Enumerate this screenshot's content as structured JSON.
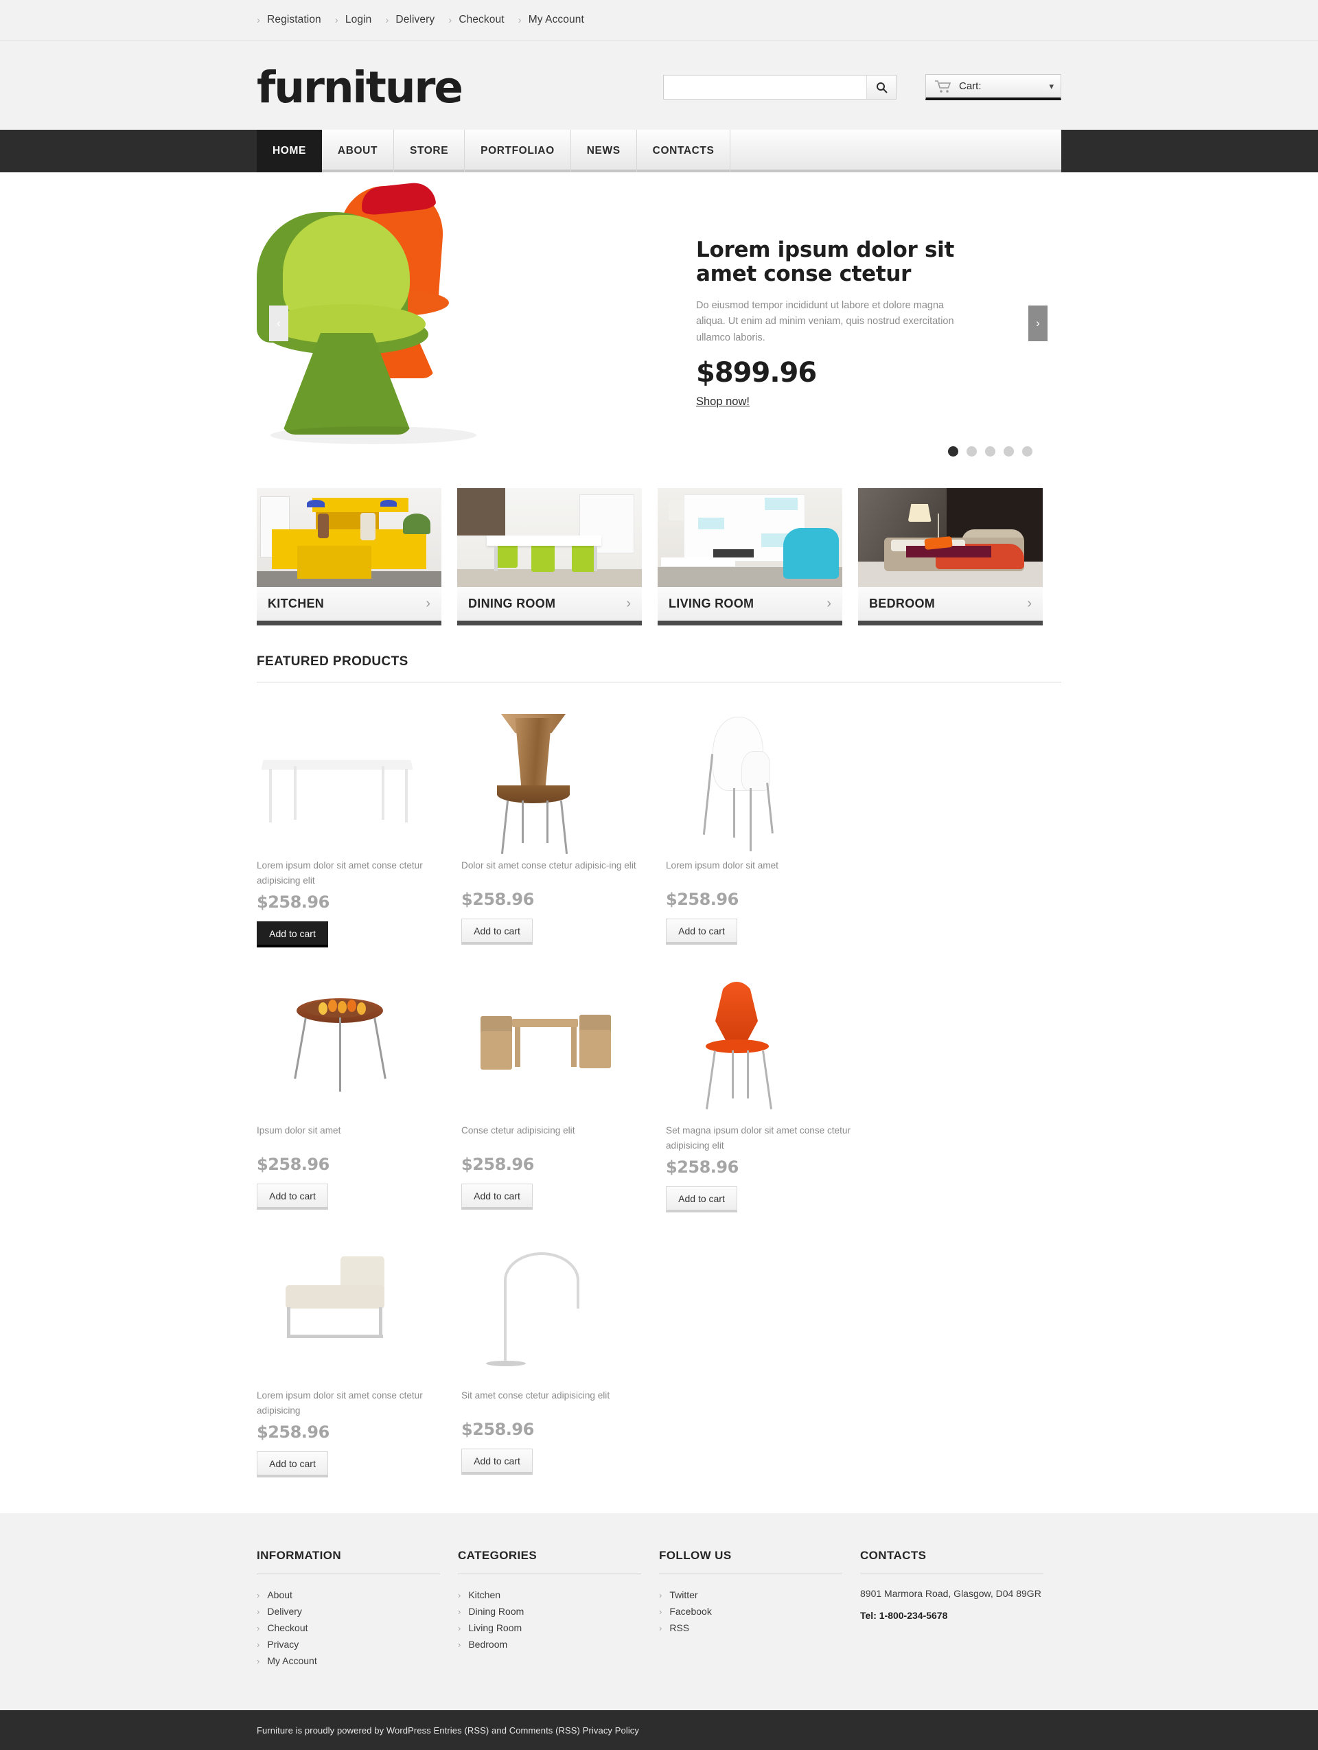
{
  "topbar": {
    "items": [
      {
        "label": "Registation"
      },
      {
        "label": "Login"
      },
      {
        "label": "Delivery"
      },
      {
        "label": "Checkout"
      },
      {
        "label": "My Account"
      }
    ]
  },
  "header": {
    "logo": "furniture",
    "search": {
      "value": "",
      "placeholder": ""
    },
    "cart": {
      "label": "Cart:",
      "caret": "▾"
    }
  },
  "nav": {
    "items": [
      {
        "label": "HOME",
        "active": true
      },
      {
        "label": "ABOUT",
        "active": false
      },
      {
        "label": "STORE",
        "active": false
      },
      {
        "label": "PORTFOLIAO",
        "active": false
      },
      {
        "label": "NEWS",
        "active": false
      },
      {
        "label": "CONTACTS",
        "active": false
      }
    ]
  },
  "slider": {
    "title": "Lorem ipsum dolor sit amet conse ctetur",
    "description": "Do eiusmod tempor incididunt ut labore et dolore magna aliqua. Ut enim ad minim veniam, quis nostrud exercitation ullamco laboris.",
    "price": "$899.96",
    "cta": "Shop now!",
    "prev_arrow": "‹",
    "next_arrow": "›",
    "dots": 5,
    "active_dot": 0
  },
  "categories": [
    {
      "name": "KITCHEN",
      "chevron": "›"
    },
    {
      "name": "DINING ROOM",
      "chevron": "›"
    },
    {
      "name": "LIVING ROOM",
      "chevron": "›"
    },
    {
      "name": "BEDROOM",
      "chevron": "›"
    }
  ],
  "featured": {
    "title": "FEATURED PRODUCTS",
    "products": [
      {
        "name": "Lorem ipsum dolor sit amet conse ctetur adipisicing elit",
        "price": "$258.96",
        "button": "Add to cart",
        "highlighted": true
      },
      {
        "name": "Dolor sit amet conse ctetur adipisic-ing elit",
        "price": "$258.96",
        "button": "Add to cart",
        "highlighted": false
      },
      {
        "name": "Lorem ipsum dolor sit amet",
        "price": "$258.96",
        "button": "Add to cart",
        "highlighted": false
      },
      {
        "name": "Ipsum dolor sit amet",
        "price": "$258.96",
        "button": "Add to cart",
        "highlighted": false
      },
      {
        "name": "Conse ctetur adipisicing elit",
        "price": "$258.96",
        "button": "Add to cart",
        "highlighted": false
      },
      {
        "name": "Set magna ipsum dolor sit amet conse ctetur adipisicing elit",
        "price": "$258.96",
        "button": "Add to cart",
        "highlighted": false
      },
      {
        "name": "Lorem ipsum dolor sit amet conse ctetur adipisicing",
        "price": "$258.96",
        "button": "Add to cart",
        "highlighted": false
      },
      {
        "name": "Sit amet conse ctetur adipisicing elit",
        "price": "$258.96",
        "button": "Add to cart",
        "highlighted": false
      }
    ]
  },
  "footer": {
    "information": {
      "title": "INFORMATION",
      "links": [
        {
          "label": "About"
        },
        {
          "label": "Delivery"
        },
        {
          "label": "Checkout"
        },
        {
          "label": "Privacy"
        },
        {
          "label": "My Account"
        }
      ]
    },
    "categories": {
      "title": "CATEGORIES",
      "links": [
        {
          "label": "Kitchen"
        },
        {
          "label": "Dining Room"
        },
        {
          "label": "Living Room"
        },
        {
          "label": "Bedroom"
        }
      ]
    },
    "follow": {
      "title": "FOLLOW US",
      "links": [
        {
          "label": "Twitter"
        },
        {
          "label": "Facebook"
        },
        {
          "label": "RSS"
        }
      ]
    },
    "contacts": {
      "title": "CONTACTS",
      "address": "8901 Marmora Road, Glasgow, D04 89GR",
      "tel": "Tel: 1-800-234-5678"
    },
    "chevron": "›"
  },
  "copyright": {
    "text": "Furniture is proudly powered by WordPress Entries (RSS) and Comments (RSS) Privacy Policy"
  },
  "colors": {
    "accent_dark": "#1c1c1c",
    "bar_bg": "#f2f2f2",
    "nav_bg": "#2d2d2d",
    "price_gray": "#a5a5a5"
  }
}
